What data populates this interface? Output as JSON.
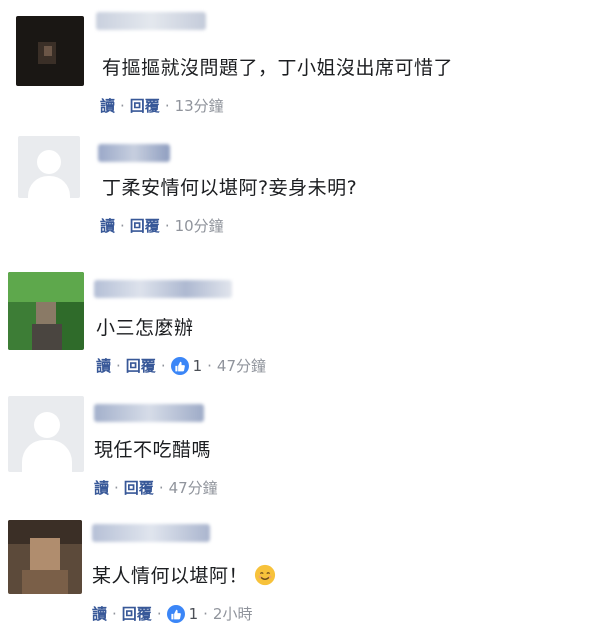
{
  "comments": [
    {
      "text": "有摳摳就沒問題了，丁小姐沒出席可惜了",
      "actions": {
        "read": "讀",
        "reply": "回覆",
        "time": "13分鐘"
      },
      "reactions": null
    },
    {
      "text": "丁柔安情何以堪阿?妾身未明?",
      "actions": {
        "read": "讀",
        "reply": "回覆",
        "time": "10分鐘"
      },
      "reactions": null
    },
    {
      "text": "小三怎麼辦",
      "actions": {
        "read": "讀",
        "reply": "回覆",
        "time": "47分鐘"
      },
      "reactions": {
        "icon": "like-icon",
        "count": "1"
      }
    },
    {
      "text": "現任不吃醋嗎",
      "actions": {
        "read": "讀",
        "reply": "回覆",
        "time": "47分鐘"
      },
      "reactions": null
    },
    {
      "text": "某人情何以堪阿！",
      "emoji": "smiling-face-icon",
      "actions": {
        "read": "讀",
        "reply": "回覆",
        "time": "2小時"
      },
      "reactions": {
        "icon": "like-icon",
        "count": "1"
      }
    }
  ],
  "colors": {
    "link": "#385898",
    "meta": "#90949c",
    "like": "#3b86f7"
  }
}
